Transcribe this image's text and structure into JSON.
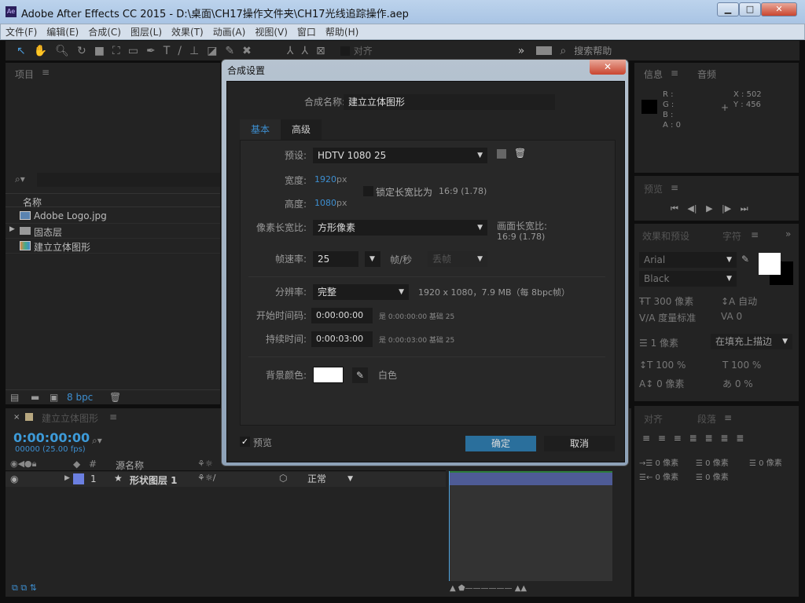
{
  "window": {
    "app_icon": "Ae",
    "title": "Adobe After Effects CC 2015 - D:\\桌面\\CH17操作文件夹\\CH17光线追踪操作.aep",
    "minimize": "▁",
    "maximize": "□",
    "close": "✕"
  },
  "menu": [
    "文件(F)",
    "编辑(E)",
    "合成(C)",
    "图层(L)",
    "效果(T)",
    "动画(A)",
    "视图(V)",
    "窗口",
    "帮助(H)"
  ],
  "toolbar": {
    "snap_label": "对齐",
    "overflow": "»",
    "search_help": "搜索帮助"
  },
  "project": {
    "title": "项目",
    "col_name": "名称",
    "items": [
      {
        "name": "Adobe Logo.jpg",
        "type": "image"
      },
      {
        "name": "固态层",
        "type": "folder"
      },
      {
        "name": "建立立体图形",
        "type": "comp"
      }
    ],
    "bpc": "8 bpc"
  },
  "timeline": {
    "comp_tab": "建立立体图形",
    "timecode": "0:00:00:00",
    "frames": "00000 (25.00 fps)",
    "col_num": "#",
    "col_source": "源名称",
    "layer": {
      "index": "1",
      "name": "形状图层 1",
      "mode": "正常",
      "color": "#6b7fe0"
    }
  },
  "info": {
    "tab": "信息",
    "tab2": "音频",
    "r": "R :",
    "g": "G :",
    "b": "B :",
    "a": "A : 0",
    "x": "X : 502",
    "y": "Y : 456"
  },
  "preview": {
    "tab": "预览"
  },
  "character": {
    "tab1": "效果和预设",
    "tab2": "字符",
    "font": "Arial",
    "style": "Black",
    "size": "300 像素",
    "leading": "自动",
    "kerning": "度量标准",
    "tracking": "0",
    "stroke": "1 像素",
    "stroke_mode": "在填充上描边",
    "vscale": "100 %",
    "hscale": "100 %",
    "baseline": "0 像素",
    "tsume": "0 %"
  },
  "paragraph": {
    "tab1": "对齐",
    "tab2": "段落",
    "indent_left": "0 像素",
    "space_before": "0 像素",
    "first_line": "0 像素",
    "indent_right": "0 像素",
    "space_after": "0 像素"
  },
  "dialog": {
    "title": "合成设置",
    "close": "✕",
    "comp_name_label": "合成名称:",
    "comp_name": "建立立体图形",
    "tabs": [
      "基本",
      "高级"
    ],
    "preset_label": "预设:",
    "preset": "HDTV 1080 25",
    "width_label": "宽度:",
    "width": "1920",
    "height_label": "高度:",
    "height": "1080",
    "unit": "px",
    "lock_label": "锁定长宽比为",
    "lock_ratio": "16:9 (1.78)",
    "par_label": "像素长宽比:",
    "par": "方形像素",
    "frame_ar_label": "画面长宽比:",
    "frame_ar": "16:9 (1.78)",
    "fps_label": "帧速率:",
    "fps": "25",
    "fps_unit": "帧/秒",
    "drop": "丢帧",
    "res_label": "分辨率:",
    "res": "完整",
    "res_info": "1920 x 1080，7.9 MB（每 8bpc帧）",
    "start_label": "开始时间码:",
    "start": "0:00:00:00",
    "start_info": "是 0:00:00:00  基础 25",
    "dur_label": "持续时间:",
    "dur": "0:00:03:00",
    "dur_info": "是 0:00:03:00  基础 25",
    "bg_label": "背景颜色:",
    "bg_name": "白色",
    "bg_color": "#ffffff",
    "preview_label": "预览",
    "ok": "确定",
    "cancel": "取消"
  }
}
